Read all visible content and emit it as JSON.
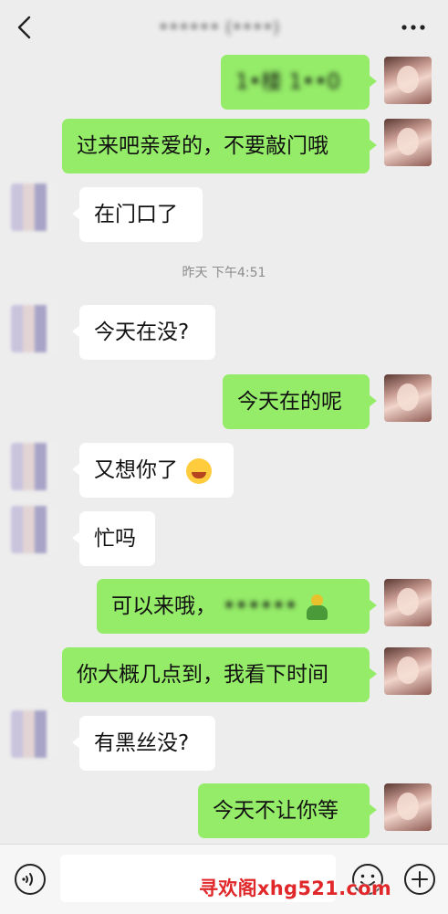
{
  "header": {
    "title": "•••••• (••••)",
    "back_icon": "chevron-left-icon",
    "more_icon": "more-dots-icon"
  },
  "messages": [
    {
      "side": "right",
      "text": "1•楼 1••0",
      "blurred": true
    },
    {
      "side": "right",
      "text": "过来吧亲爱的，不要敲门哦"
    },
    {
      "side": "left",
      "text": "在门口了"
    },
    {
      "side": "left",
      "text": "今天在没?"
    },
    {
      "side": "right",
      "text": "今天在的呢"
    },
    {
      "side": "left",
      "text": "又想你了",
      "emoji": "rofl-emoji"
    },
    {
      "side": "left",
      "text": "忙吗"
    },
    {
      "side": "right",
      "text": "可以来哦，",
      "blurred_tail": "••••••",
      "emoji": "figure-emoji"
    },
    {
      "side": "right",
      "text": "你大概几点到，我看下时间"
    },
    {
      "side": "left",
      "text": "有黑丝没?"
    },
    {
      "side": "right",
      "text": "今天不让你等"
    }
  ],
  "timestamp": "昨天 下午4:51",
  "input_bar": {
    "voice_icon": "voice-icon",
    "emoji_icon": "smiley-icon",
    "plus_icon": "plus-circle-icon"
  },
  "watermark": "寻欢阁xhg521.com",
  "colors": {
    "background": "#ededed",
    "bubble_sent": "#95ec69",
    "bubble_received": "#ffffff",
    "watermark": "#e0272a"
  }
}
